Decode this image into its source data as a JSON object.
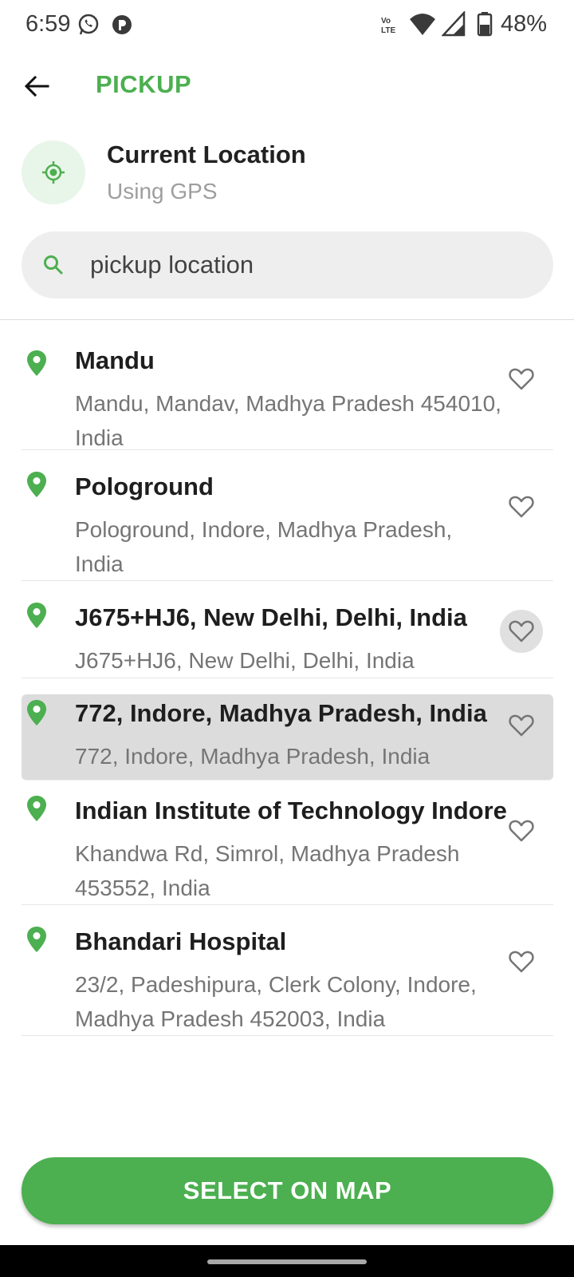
{
  "status_bar": {
    "time": "6:59",
    "battery": "48%",
    "network_label": "Vo) LTE"
  },
  "header": {
    "title": "PICKUP"
  },
  "current_location": {
    "title": "Current Location",
    "subtitle": "Using GPS"
  },
  "search": {
    "placeholder": "pickup location",
    "value": ""
  },
  "results": [
    {
      "title": "Mandu",
      "subtitle": "Mandu, Mandav, Madhya Pradesh 454010, India"
    },
    {
      "title": "Pologround",
      "subtitle": "Pologround, Indore, Madhya Pradesh, India"
    },
    {
      "title": "J675+HJ6, New Delhi, Delhi, India",
      "subtitle": "J675+HJ6, New Delhi, Delhi, India"
    },
    {
      "title": "772, Indore, Madhya Pradesh, India",
      "subtitle": "772, Indore, Madhya Pradesh, India"
    },
    {
      "title": "Indian Institute of Technology Indore",
      "subtitle": "Khandwa Rd, Simrol, Madhya Pradesh 453552, India"
    },
    {
      "title": "Bhandari Hospital",
      "subtitle": "23/2, Padeshipura, Clerk Colony, Indore, Madhya Pradesh 452003, India"
    }
  ],
  "footer": {
    "select_on_map_label": "SELECT ON MAP"
  },
  "colors": {
    "accent": "#4caf50",
    "accent_light": "#e8f5e9",
    "selected_row": "#dcdcdc"
  }
}
